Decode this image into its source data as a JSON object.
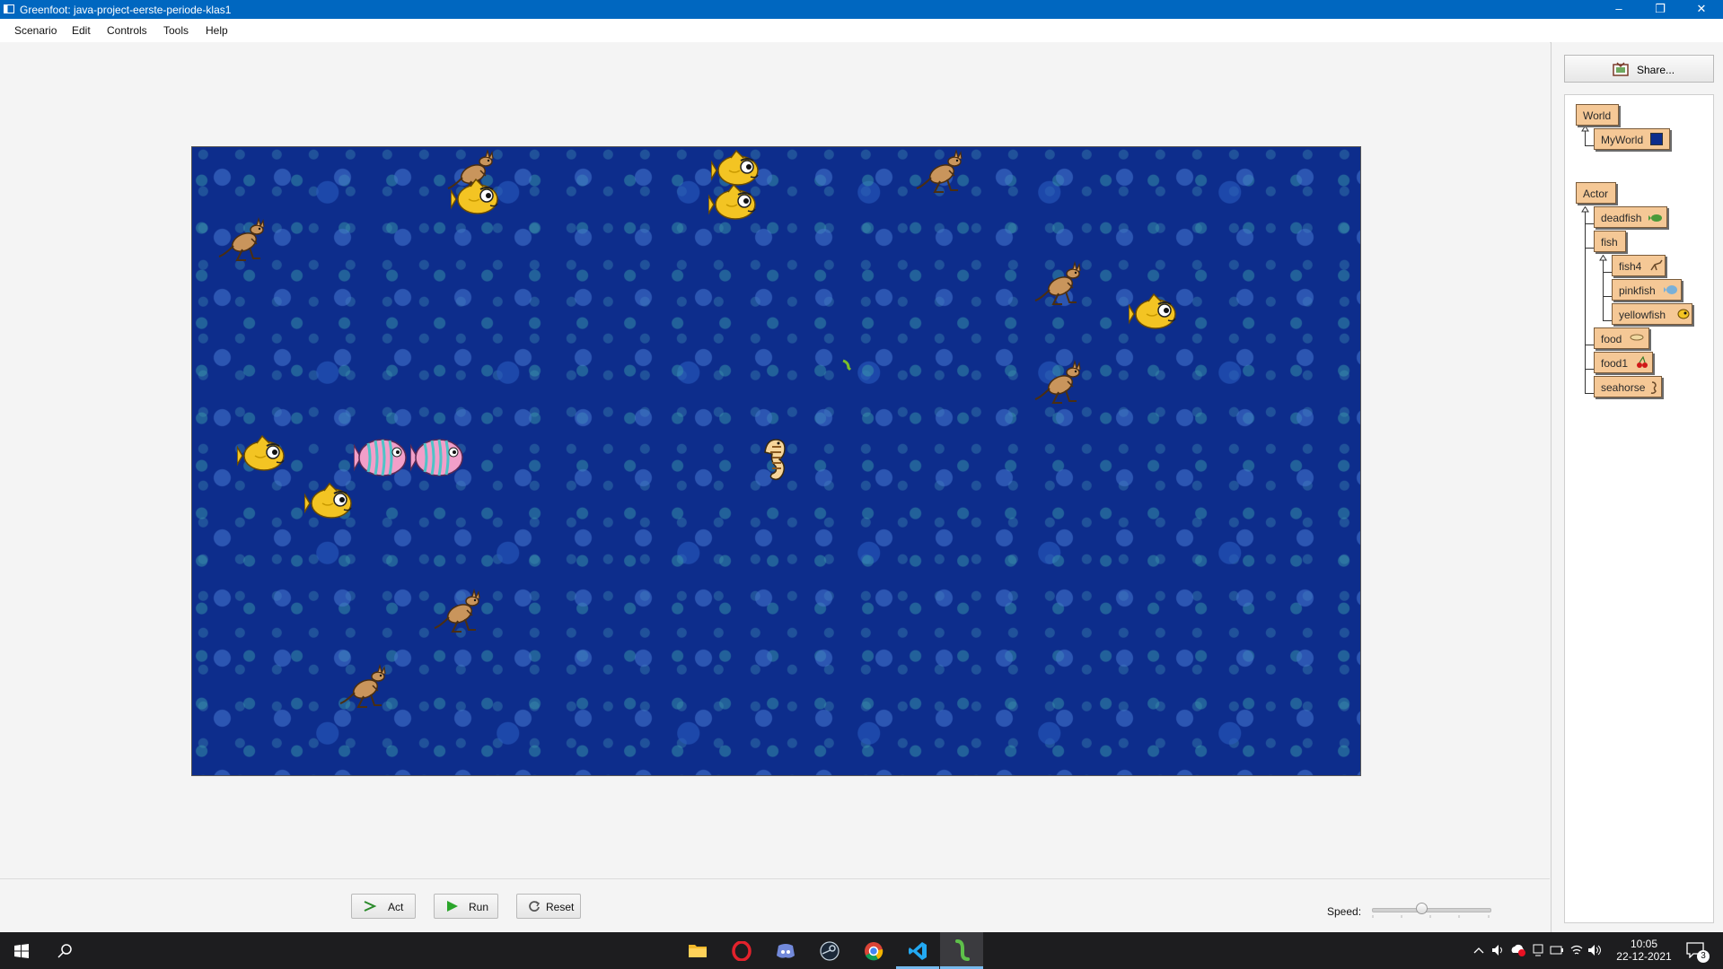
{
  "window": {
    "title": "Greenfoot: java-project-eerste-periode-klas1",
    "controls": [
      "minimize-icon",
      "restore-icon",
      "close-icon"
    ]
  },
  "menu": [
    "Scenario",
    "Edit",
    "Controls",
    "Tools",
    "Help"
  ],
  "world": {
    "background": "bubbles",
    "actors": [
      {
        "name": "kangaroo-actor"
      },
      {
        "name": "yellowfish-actor"
      },
      {
        "name": "kangaroo-actor"
      },
      {
        "name": "yellowfish-actor"
      },
      {
        "name": "yellowfish-actor"
      },
      {
        "name": "kangaroo-actor"
      },
      {
        "name": "kangaroo-actor"
      },
      {
        "name": "yellowfish-actor"
      },
      {
        "name": "kangaroo-actor"
      },
      {
        "name": "food-actor"
      },
      {
        "name": "yellowfish-actor"
      },
      {
        "name": "pinkfish-actor"
      },
      {
        "name": "pinkfish-actor"
      },
      {
        "name": "yellowfish-actor"
      },
      {
        "name": "seahorse-actor"
      },
      {
        "name": "kangaroo-actor"
      },
      {
        "name": "kangaroo-actor"
      }
    ]
  },
  "controls": {
    "act_label": "Act",
    "run_label": "Run",
    "reset_label": "Reset",
    "speed_label": "Speed:",
    "speed_fraction": 0.42
  },
  "sidebar": {
    "share_label": "Share...",
    "classes": {
      "world": "World",
      "myworld": "MyWorld",
      "actor": "Actor",
      "deadfish": "deadfish",
      "fish": "fish",
      "fish4": "fish4",
      "pinkfish": "pinkfish",
      "yellowfish": "yellowfish",
      "food": "food",
      "food1": "food1",
      "seahorse": "seahorse"
    }
  },
  "taskbar": {
    "apps": [
      "windows-start-icon",
      "search-icon",
      "file-explorer-icon",
      "opera-icon",
      "discord-icon",
      "steam-icon",
      "chrome-icon",
      "vscode-icon",
      "greenfoot-icon"
    ],
    "time": "10:05",
    "date": "22-12-2021",
    "notification_count": "3"
  },
  "colors": {
    "title_bar": "#0067c0",
    "world_water": "#0d2d8c",
    "class_box": "#f5c896",
    "taskbar": "#1d1d1f"
  }
}
